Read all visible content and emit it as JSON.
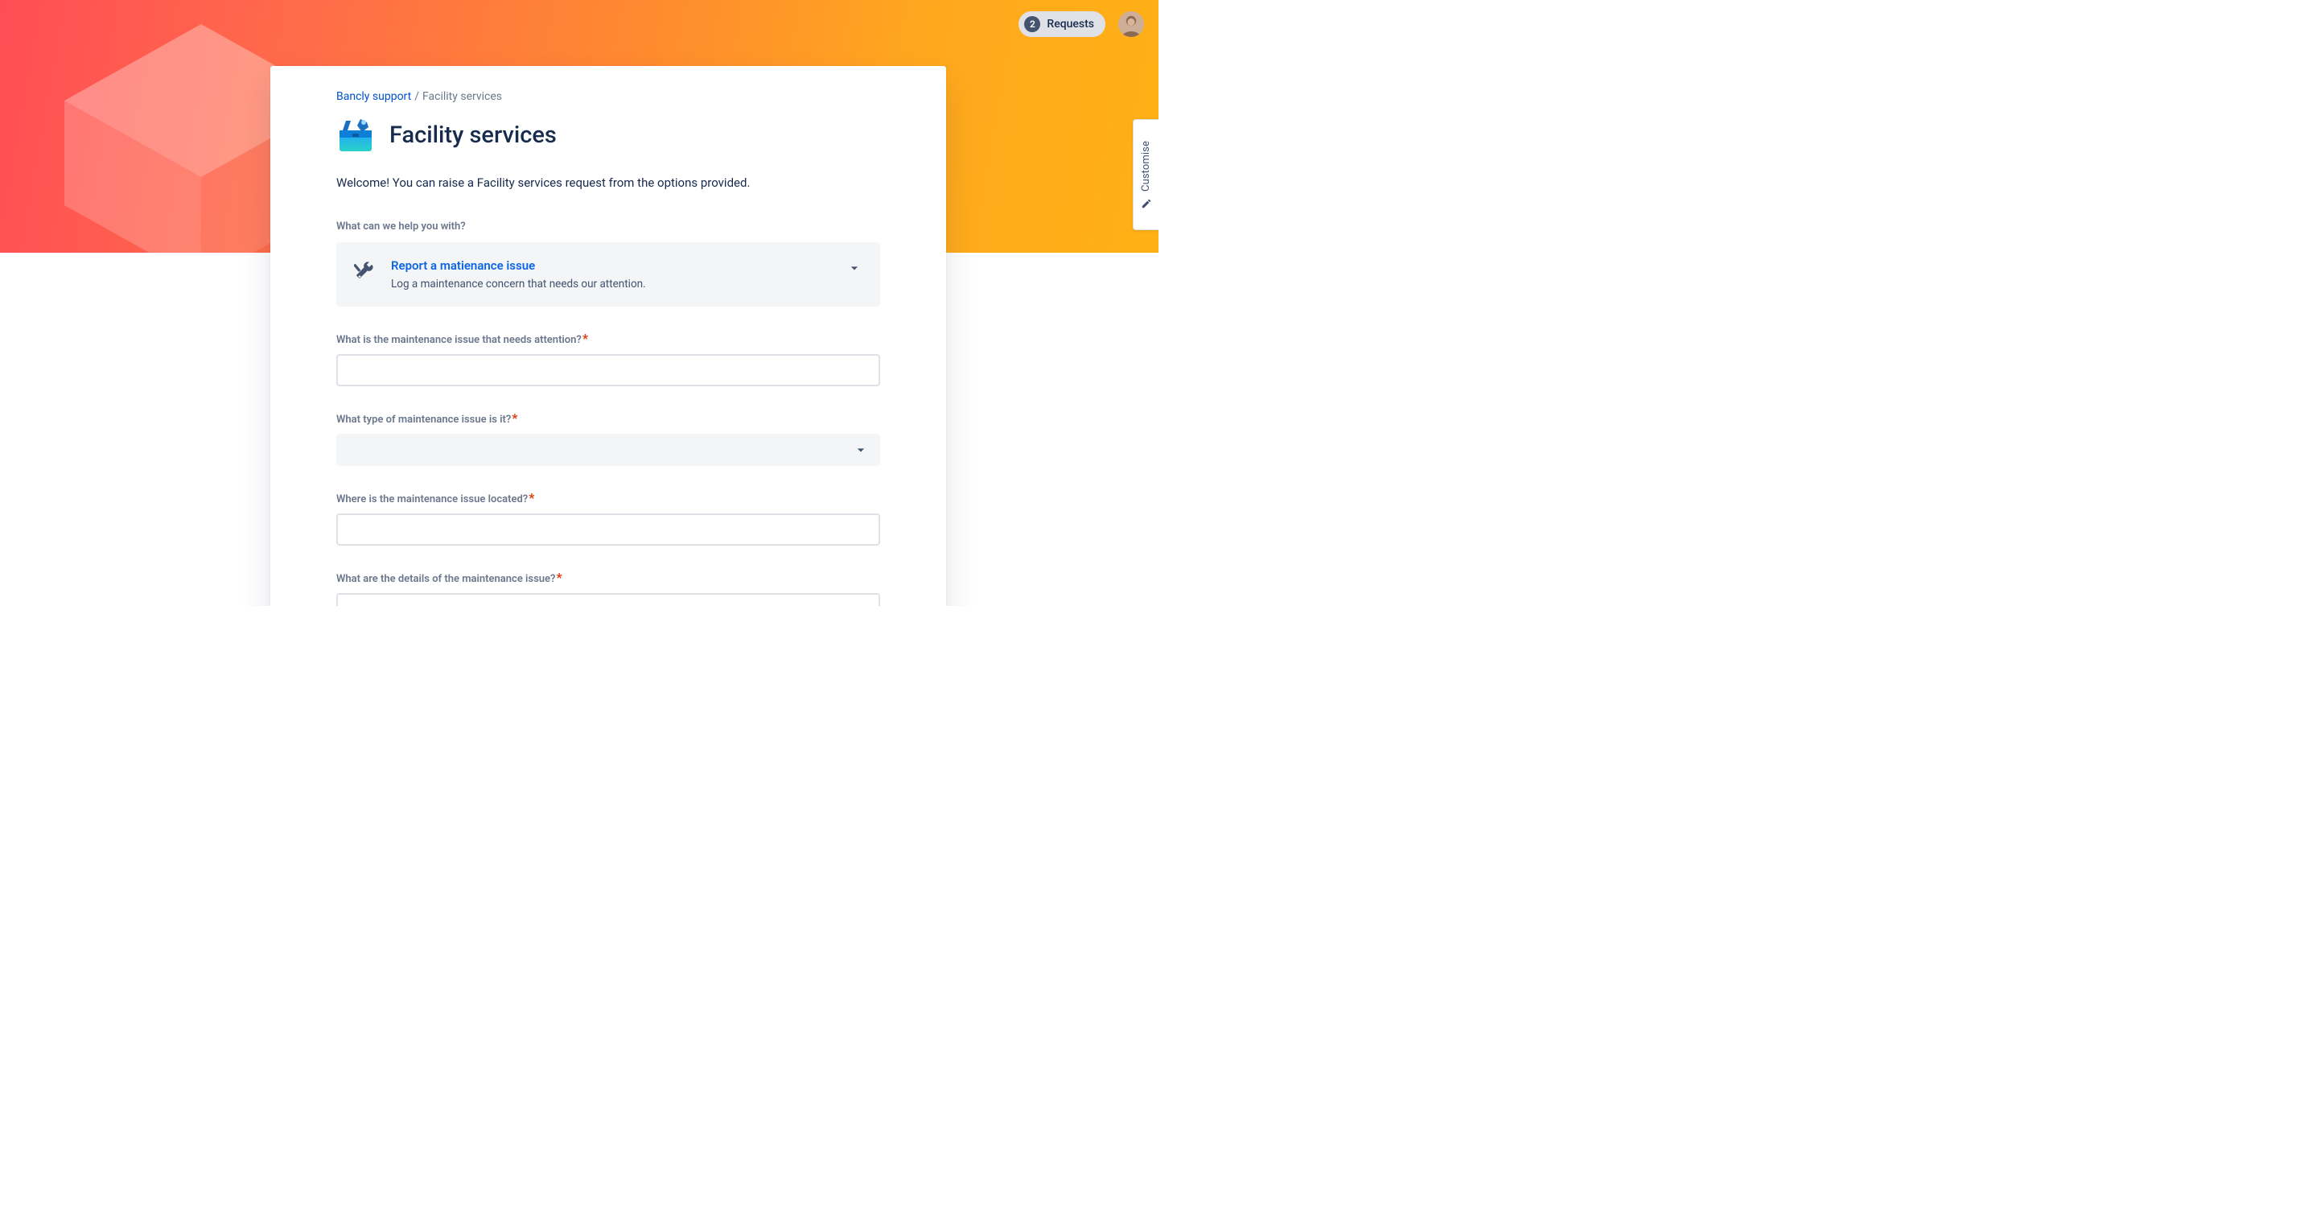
{
  "topbar": {
    "requests": {
      "count": "2",
      "label": "Requests"
    }
  },
  "customise_tab": {
    "label": "Customise"
  },
  "breadcrumb": {
    "root_label": "Bancly support",
    "separator": "/",
    "current_label": "Facility services"
  },
  "page": {
    "title": "Facility services",
    "welcome": "Welcome! You can raise a Facility services request from the options provided."
  },
  "help_section": {
    "label": "What can we help you with?"
  },
  "request_type": {
    "title": "Report a matienance issue",
    "description": "Log a maintenance concern that needs our attention."
  },
  "form": {
    "issue_summary": {
      "label": "What is the maintenance issue that needs attention?",
      "required": true,
      "value": ""
    },
    "issue_type": {
      "label": "What type of maintenance issue is it?",
      "required": true,
      "selected": ""
    },
    "issue_location": {
      "label": "Where is the maintenance issue located?",
      "required": true,
      "value": ""
    },
    "issue_details": {
      "label": "What are the details of the maintenance issue?",
      "required": true,
      "value": ""
    }
  },
  "required_marker": "*"
}
